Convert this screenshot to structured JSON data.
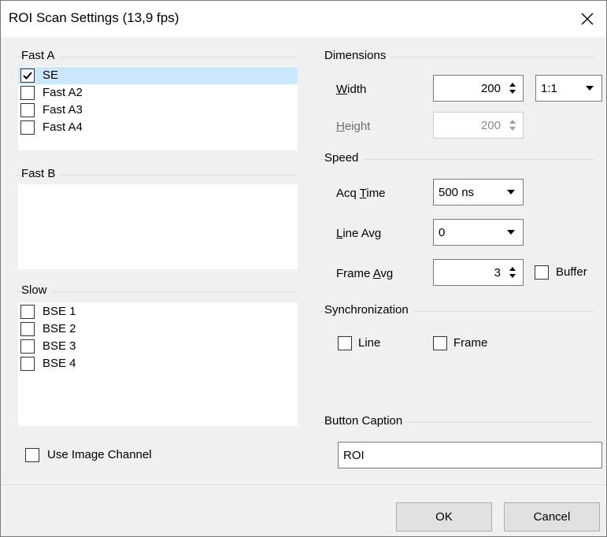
{
  "window": {
    "title": "ROI Scan Settings (13,9 fps)"
  },
  "fast_a": {
    "title": "Fast A",
    "items": [
      {
        "label": "SE",
        "checked": true,
        "selected": true
      },
      {
        "label": "Fast A2",
        "checked": false
      },
      {
        "label": "Fast A3",
        "checked": false
      },
      {
        "label": "Fast A4",
        "checked": false
      }
    ]
  },
  "fast_b": {
    "title": "Fast B",
    "items": []
  },
  "slow": {
    "title": "Slow",
    "items": [
      {
        "label": "BSE 1",
        "checked": false
      },
      {
        "label": "BSE 2",
        "checked": false
      },
      {
        "label": "BSE 3",
        "checked": false
      },
      {
        "label": "BSE 4",
        "checked": false
      }
    ]
  },
  "use_image_channel": {
    "label": "Use Image Channel",
    "checked": false
  },
  "dimensions": {
    "title": "Dimensions",
    "width_label_u": "W",
    "width_label_rest": "idth",
    "width_value": "200",
    "ratio_value": "1:1",
    "height_label_u": "H",
    "height_label_rest": "eight",
    "height_value": "200"
  },
  "speed": {
    "title": "Speed",
    "acq_label_pre": "Acq ",
    "acq_label_u": "T",
    "acq_label_rest": "ime",
    "acq_value": "500 ns",
    "line_avg_label_u": "L",
    "line_avg_label_rest": "ine Avg",
    "line_avg_value": "0",
    "frame_avg_label_pre": "Frame ",
    "frame_avg_label_u": "A",
    "frame_avg_label_rest": "vg",
    "frame_avg_value": "3",
    "buffer_label": "Buffer"
  },
  "sync": {
    "title": "Synchronization",
    "line_label": "Line",
    "frame_label": "Frame"
  },
  "caption": {
    "title": "Button Caption",
    "value": "ROI"
  },
  "buttons": {
    "ok": "OK",
    "cancel": "Cancel"
  },
  "colors": {
    "selection": "#cce8ff",
    "dialog_bg": "#f0f0f0"
  }
}
